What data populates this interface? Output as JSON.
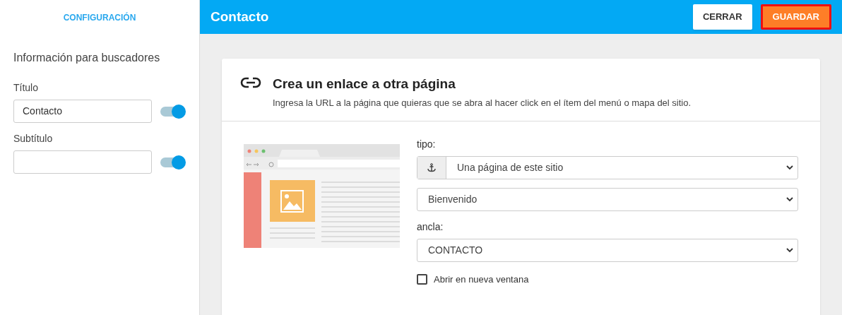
{
  "sidebar": {
    "tab": "CONFIGURACIÓN",
    "section_title": "Información para buscadores",
    "fields": [
      {
        "label": "Título",
        "value": "Contacto",
        "on": true
      },
      {
        "label": "Subtítulo",
        "on": true
      }
    ]
  },
  "header": {
    "title": "Contacto",
    "buttons": [
      {
        "label": "CERRAR",
        "kind": "secondary"
      },
      {
        "label": "GUARDAR",
        "kind": "primary"
      }
    ]
  },
  "card": {
    "title": "Crea un enlace a otra página",
    "description": "Ingresa la URL a la página que quieras que se abra al hacer click en el ítem del menú o mapa del sitio.",
    "form": [
      {
        "label": "tipo:",
        "value": "Una página de este sitio",
        "kind": "anchor-select"
      },
      {
        "value": "Bienvenido",
        "kind": "select"
      },
      {
        "label": "ancla:",
        "value": "CONTACTO",
        "kind": "select"
      }
    ],
    "checkbox": {
      "label": "Abrir en nueva ventana",
      "checked": false
    }
  }
}
